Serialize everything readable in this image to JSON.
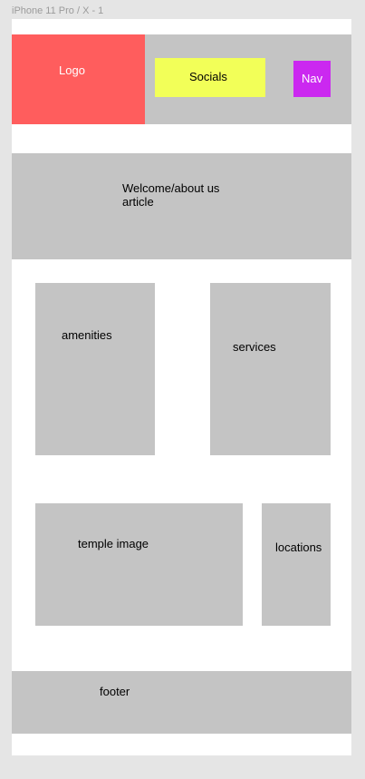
{
  "frame": {
    "label": "iPhone 11 Pro / X - 1"
  },
  "header": {
    "logo_label": "Logo",
    "socials_label": "Socials",
    "nav_label": "Nav"
  },
  "welcome": {
    "label": "Welcome/about us article"
  },
  "amenities": {
    "label": "amenities"
  },
  "services": {
    "label": "services"
  },
  "temple": {
    "label": "temple image"
  },
  "locations": {
    "label": "locations"
  },
  "footer": {
    "label": "footer"
  },
  "colors": {
    "canvas": "#e5e5e5",
    "frame": "#ffffff",
    "placeholder": "#c4c4c4",
    "logo": "#ff5d5d",
    "socials": "#f2ff58",
    "nav": "#cb28f0"
  }
}
